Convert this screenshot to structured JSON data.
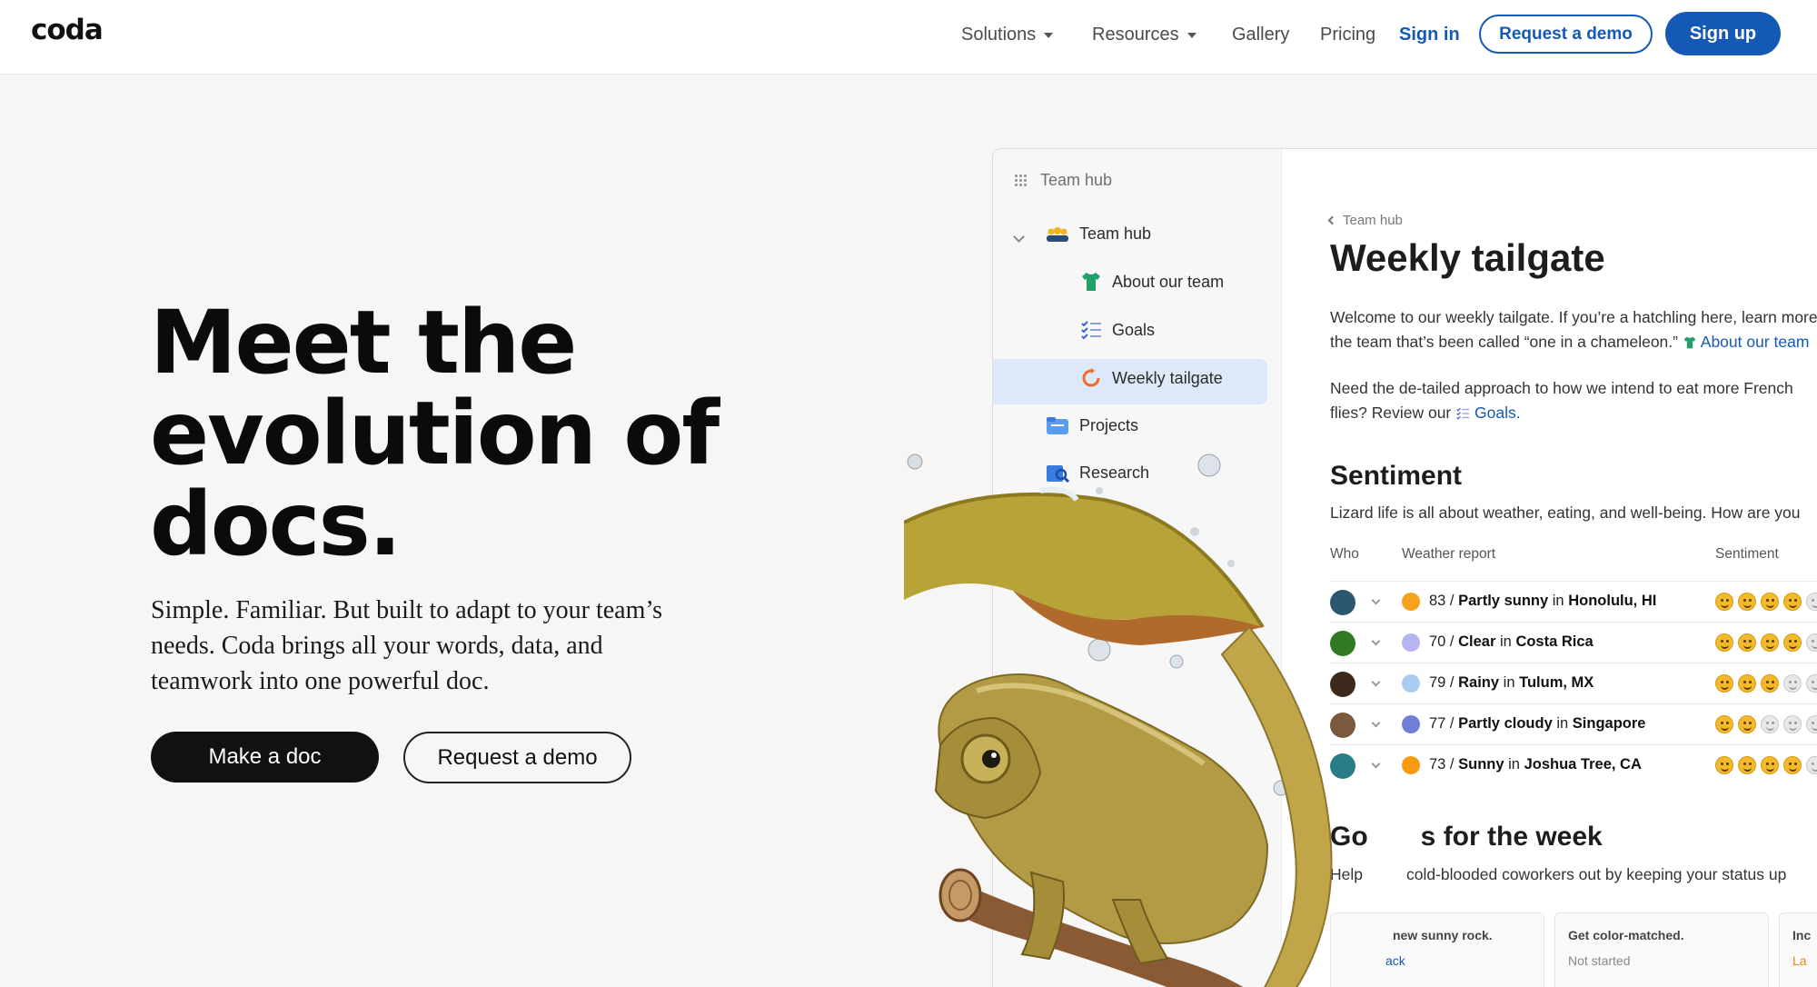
{
  "nav": {
    "logo": "coda",
    "solutions": "Solutions",
    "resources": "Resources",
    "gallery": "Gallery",
    "pricing": "Pricing",
    "sign_in": "Sign in",
    "request_demo": "Request a demo",
    "sign_up": "Sign up"
  },
  "hero": {
    "title_line1": "Meet the",
    "title_line2": "evolution of",
    "title_line3": "docs.",
    "subtitle_line1": "Simple. Familiar. But built to adapt to your team’s",
    "subtitle_line2": "needs. Coda brings all your words, data, and",
    "subtitle_line3": "teamwork into one powerful doc.",
    "make_doc": "Make a doc",
    "request_demo": "Request a demo"
  },
  "doc": {
    "sidebar": {
      "top": "Team hub",
      "items": [
        {
          "label": "Team hub"
        },
        {
          "label": "About our team"
        },
        {
          "label": "Goals"
        },
        {
          "label": "Weekly tailgate"
        },
        {
          "label": "Projects"
        },
        {
          "label": "Research"
        }
      ]
    },
    "breadcrumb": "Team hub",
    "title": "Weekly tailgate",
    "intro_line1": "Welcome to our weekly tailgate. If you’re a hatchling here, learn more about",
    "intro_line2_prefix": "the team that’s been called “one in a chameleon.”",
    "intro_link": "About our team",
    "need_line1": "Need the de-tailed approach to how we intend to eat more French",
    "need_line2_prefix": "flies? Review our",
    "need_link": "Goals.",
    "sentiment_heading": "Sentiment",
    "sentiment_desc": "Lizard life is all about weather, eating, and well-being. How are you",
    "columns": {
      "who": "Who",
      "weather": "Weather report",
      "sentiment": "Sentiment"
    },
    "rows": [
      {
        "temp": "83 /",
        "cond": "Partly sunny",
        "in": "in",
        "place": "Honolulu, HI",
        "dot": "#f7a21b",
        "avatar": "#2d5670",
        "happy": 4
      },
      {
        "temp": "70 /",
        "cond": "Clear",
        "in": "in",
        "place": "Costa Rica",
        "dot": "#b7b4f2",
        "avatar": "#2f7a22",
        "happy": 4
      },
      {
        "temp": "79 /",
        "cond": "Rainy",
        "in": "in",
        "place": "Tulum, MX",
        "dot": "#a9cdf0",
        "avatar": "#3d2a1c",
        "happy": 3
      },
      {
        "temp": "77 /",
        "cond": "Partly cloudy",
        "in": "in",
        "place": "Singapore",
        "dot": "#6f7fd8",
        "avatar": "#7a5a3e",
        "happy": 2
      },
      {
        "temp": "73 /",
        "cond": "Sunny",
        "in": "in",
        "place": "Joshua Tree, CA",
        "dot": "#f79c12",
        "avatar": "#2a7d88",
        "happy": 4
      }
    ],
    "goals_heading_a": "Go",
    "goals_heading_b": "s for the week",
    "goals_desc_a": "Help",
    "goals_desc_b": "cold-blooded coworkers out by keeping your status up",
    "cards": [
      {
        "head": "new sunny rock.",
        "status": "ack",
        "status_color": "#1559b7"
      },
      {
        "head": "Get color-matched.",
        "status": "Not started",
        "status_color": "#888888"
      },
      {
        "head": "Inc",
        "status": "La",
        "status_color": "#e08a12"
      }
    ]
  }
}
